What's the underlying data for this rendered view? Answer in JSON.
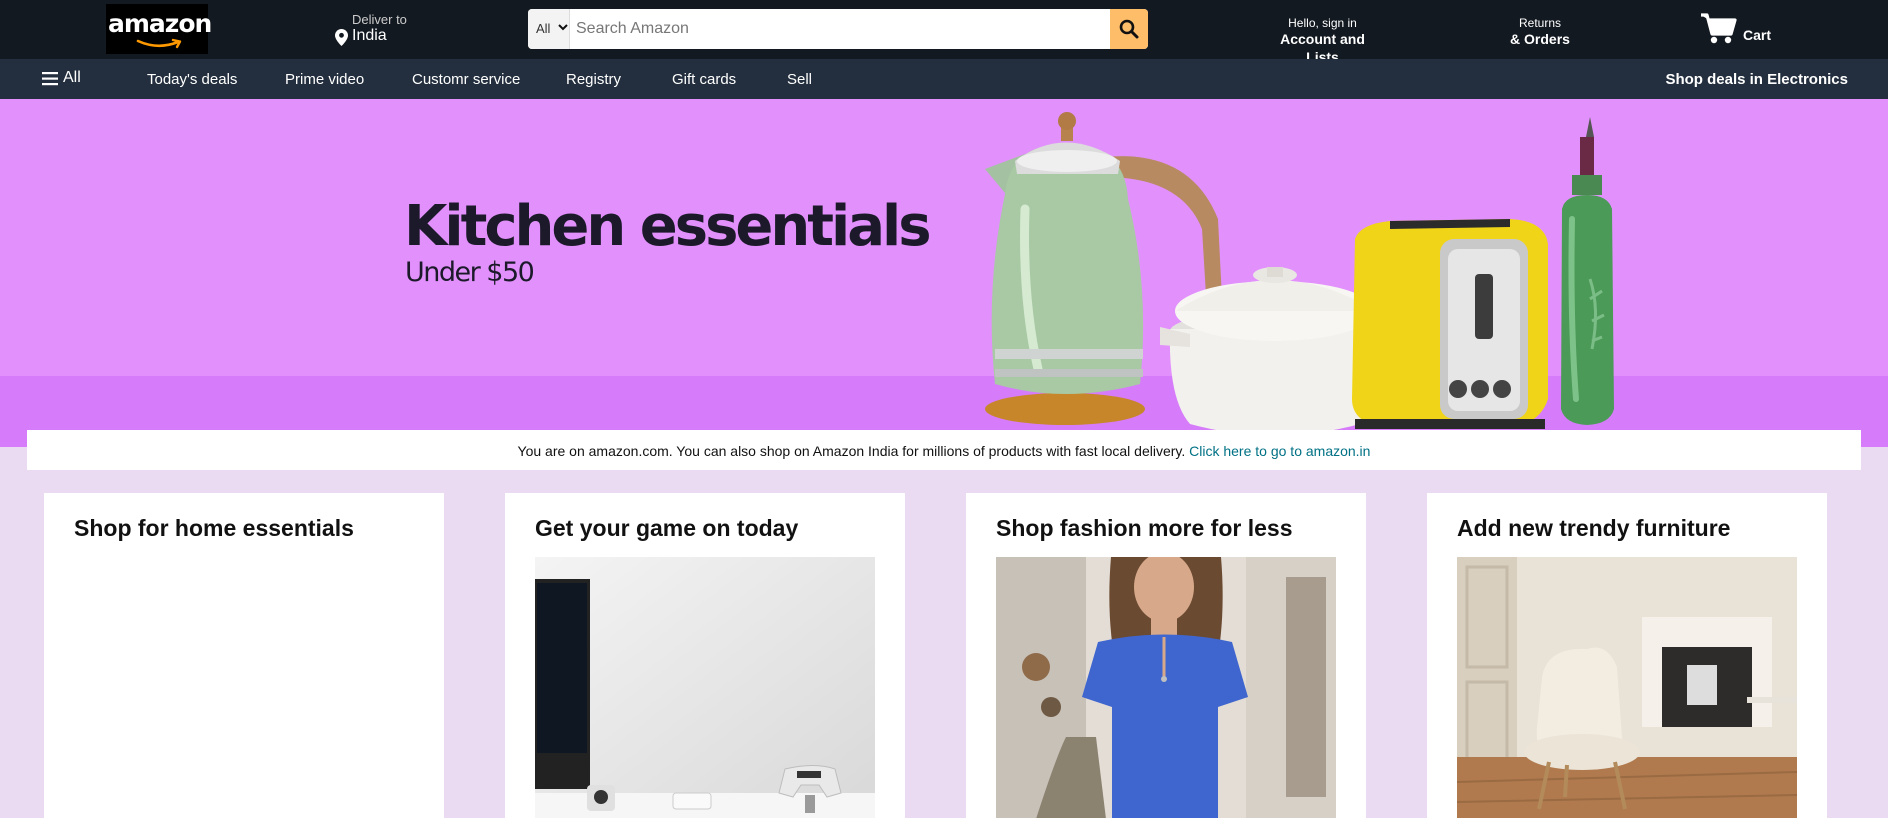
{
  "header": {
    "logo_text": "amazon",
    "deliver_small": "Deliver to",
    "deliver_location": "India",
    "search_category": "All",
    "search_placeholder": "Search Amazon",
    "account_small": "Hello, sign in",
    "account_big": "Account and Lists",
    "returns_small": "Returns",
    "returns_big": "& Orders",
    "cart_label": "Cart"
  },
  "subnav": {
    "all_label": "All",
    "items": [
      "Today's deals",
      "Prime video",
      "Customr service",
      "Registry",
      "Gift cards",
      "Sell"
    ],
    "right_label": "Shop deals in Electronics"
  },
  "hero": {
    "title": "Kitchen essentials",
    "subtitle": "Under $50"
  },
  "notice": {
    "text": "You are on amazon.com. You can also shop on Amazon India for millions of products with fast local delivery. ",
    "link": "Click here to go to amazon.in"
  },
  "cards": [
    {
      "title": "Shop for home essentials"
    },
    {
      "title": "Get your game on today"
    },
    {
      "title": "Shop fashion more for less"
    },
    {
      "title": "Add new trendy furniture"
    }
  ],
  "colors": {
    "nav_bg": "#131921",
    "subnav_bg": "#232f3e",
    "search_button": "#febd69",
    "hero_bg": "#e291fc",
    "page_bg": "#eadbf3",
    "link": "#007185"
  },
  "icons": [
    "location-pin-icon",
    "chevron-down-icon",
    "search-icon",
    "cart-icon",
    "hamburger-menu-icon"
  ]
}
